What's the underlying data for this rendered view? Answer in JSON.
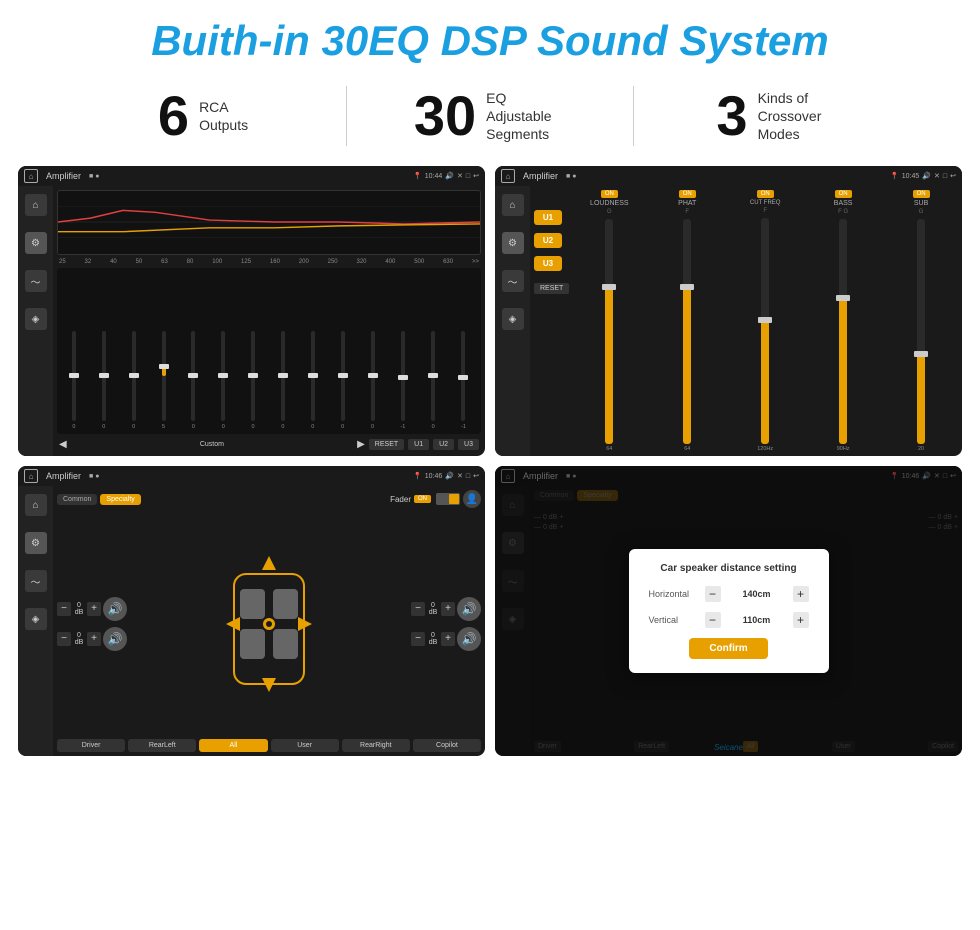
{
  "header": {
    "title": "Buith-in 30EQ DSP Sound System"
  },
  "stats": [
    {
      "number": "6",
      "label": "RCA\nOutputs"
    },
    {
      "number": "30",
      "label": "EQ Adjustable\nSegments"
    },
    {
      "number": "3",
      "label": "Kinds of\nCrossover Modes"
    }
  ],
  "screens": {
    "screen1": {
      "title": "Amplifier",
      "time": "10:44",
      "freq_labels": [
        "25",
        "32",
        "40",
        "50",
        "63",
        "80",
        "100",
        "125",
        "160",
        "200",
        "250",
        "320",
        "400",
        "500",
        "630"
      ],
      "sliders_vals": [
        "0",
        "0",
        "0",
        "5",
        "0",
        "0",
        "0",
        "0",
        "0",
        "0",
        "0",
        "-1",
        "0",
        "-1"
      ],
      "bottom_btns": [
        "Custom",
        "RESET",
        "U1",
        "U2",
        "U3"
      ]
    },
    "screen2": {
      "title": "Amplifier",
      "time": "10:45",
      "channels": [
        "LOUDNESS",
        "PHAT",
        "CUT FREQ",
        "BASS",
        "SUB"
      ],
      "u_buttons": [
        "U1",
        "U2",
        "U3"
      ],
      "reset_label": "RESET"
    },
    "screen3": {
      "title": "Amplifier",
      "time": "10:46",
      "tabs": [
        "Common",
        "Specialty"
      ],
      "fader_label": "Fader",
      "on_label": "ON",
      "db_values": [
        "0 dB",
        "0 dB",
        "0 dB",
        "0 dB"
      ],
      "bottom_btns": [
        "Driver",
        "RearLeft",
        "All",
        "User",
        "RearRight",
        "Copilot"
      ]
    },
    "screen4": {
      "title": "Amplifier",
      "time": "10:46",
      "dialog": {
        "title": "Car speaker distance setting",
        "horizontal_label": "Horizontal",
        "horizontal_val": "140cm",
        "vertical_label": "Vertical",
        "vertical_val": "110cm",
        "confirm_label": "Confirm"
      },
      "bottom_btns": [
        "Driver",
        "RearLeft",
        "All",
        "User",
        "RearRight",
        "Copilot"
      ],
      "seicane": "Seicane"
    }
  },
  "colors": {
    "accent": "#e8a000",
    "blue": "#1a9fe0",
    "dark_bg": "#1a1a1a"
  }
}
